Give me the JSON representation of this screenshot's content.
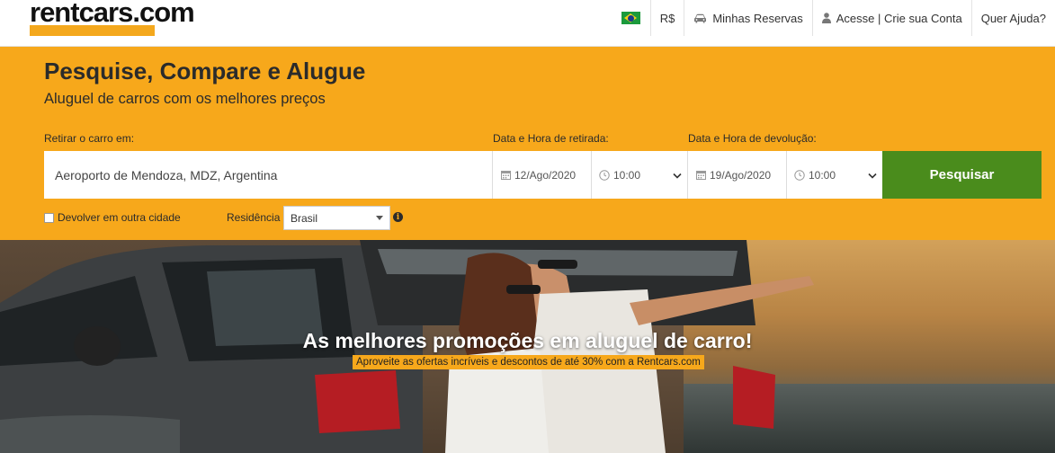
{
  "header": {
    "logo": "rentcars.com",
    "nav": {
      "flag_icon": "brazil-flag-icon",
      "currency": "R$",
      "reservations": "Minhas Reservas",
      "account": "Acesse | Crie sua Conta",
      "help": "Quer Ajuda?"
    }
  },
  "search": {
    "headline": "Pesquise, Compare e Alugue",
    "subheadline": "Aluguel de carros com os melhores preços",
    "pickup_location_label": "Retirar o carro em:",
    "pickup_location_value": "Aeroporto de Mendoza, MDZ, Argentina",
    "pickup_datetime_label": "Data e Hora de retirada:",
    "pickup_date": "12/Ago/2020",
    "pickup_time": "10:00",
    "return_datetime_label": "Data e Hora de devolução:",
    "return_date": "19/Ago/2020",
    "return_time": "10:00",
    "search_button": "Pesquisar",
    "return_other_city_label": "Devolver em outra cidade",
    "residence_label": "Residência",
    "residence_value": "Brasil",
    "info_glyph": "i"
  },
  "hero": {
    "title": "As melhores promoções em aluguel de carro!",
    "subtitle": "Aproveite as ofertas incríveis e descontos de até 30% com a Rentcars.com"
  },
  "colors": {
    "brand_orange": "#f7a81b",
    "search_green": "#4a8c1c"
  }
}
